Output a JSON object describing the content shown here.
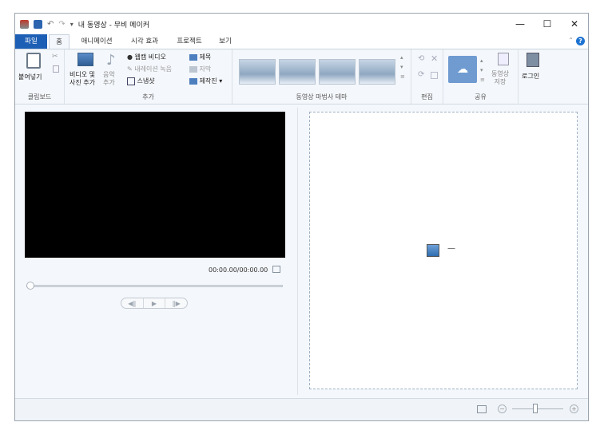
{
  "window": {
    "title": "내 동영상 - 무비 메이커",
    "minimize": "—",
    "maximize": "☐",
    "close": "✕"
  },
  "tabs": [
    "파일",
    "홈",
    "애니메이션",
    "시각 효과",
    "프로젝트",
    "보기"
  ],
  "ribbon": {
    "clipboard": {
      "label": "클립보드",
      "paste": "붙여넣기"
    },
    "add": {
      "label": "추가",
      "add_video_photo_l1": "비디오 및",
      "add_video_photo_l2": "사진 추가",
      "add_music_l1": "음악",
      "add_music_l2": "추가",
      "webcam_video": "웹캠 비디오",
      "record_narration": "내레이션 녹음",
      "snapshot": "스냅샷",
      "title": "제목",
      "caption": "자막",
      "credits": "제작진"
    },
    "themes": {
      "label": "동영상 마법사 테마"
    },
    "edit": {
      "label": "편집"
    },
    "share": {
      "label": "공유",
      "save_movie_l1": "동영상",
      "save_movie_l2": "저장"
    },
    "signin": {
      "label": "로그인"
    }
  },
  "player": {
    "timecode": "00:00.00/00:00.00",
    "play": "▶",
    "prev": "◀‖",
    "next": "‖▶"
  },
  "storyboard": {
    "placeholder_dash": "—"
  }
}
